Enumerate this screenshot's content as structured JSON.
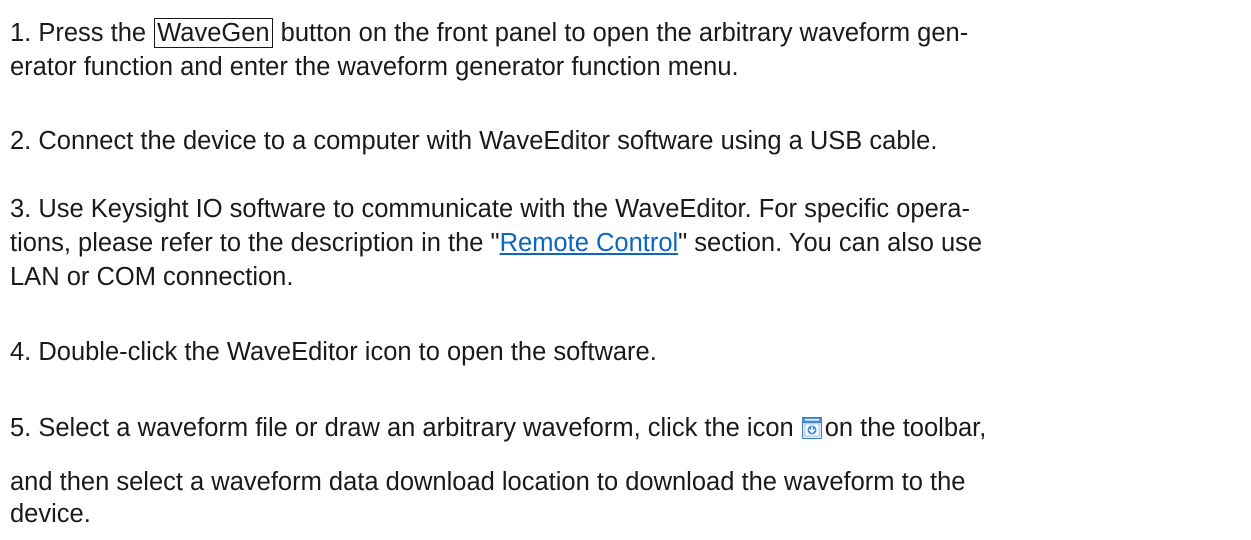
{
  "steps": {
    "s1": {
      "before": "1. Press the ",
      "key": "WaveGen",
      "after_line1": " button on the front panel to open the arbitrary waveform gen-",
      "line2": "erator function and enter the waveform generator function menu."
    },
    "s2": {
      "text": "2. Connect the device to a computer with WaveEditor software using a USB cable."
    },
    "s3": {
      "line1": "3. Use Keysight IO software to communicate with the WaveEditor. For specific opera-",
      "line2_before": "tions, please refer to the description in the \"",
      "link": "Remote Control",
      "line2_after": "\" section. You can also use",
      "line3": "LAN or COM connection."
    },
    "s4": {
      "text": "4. Double-click the WaveEditor icon to open the software."
    },
    "s5": {
      "before_icon": "5. Select a waveform file or draw an arbitrary waveform, click the icon",
      "after_icon": "on the toolbar,",
      "line2": "and then select a waveform data download location to download the waveform to the",
      "line3": "device."
    }
  },
  "icons": {
    "download_icon": "download-to-device-icon"
  },
  "colors": {
    "text": "#1a1a1a",
    "link": "#0b65c2"
  }
}
